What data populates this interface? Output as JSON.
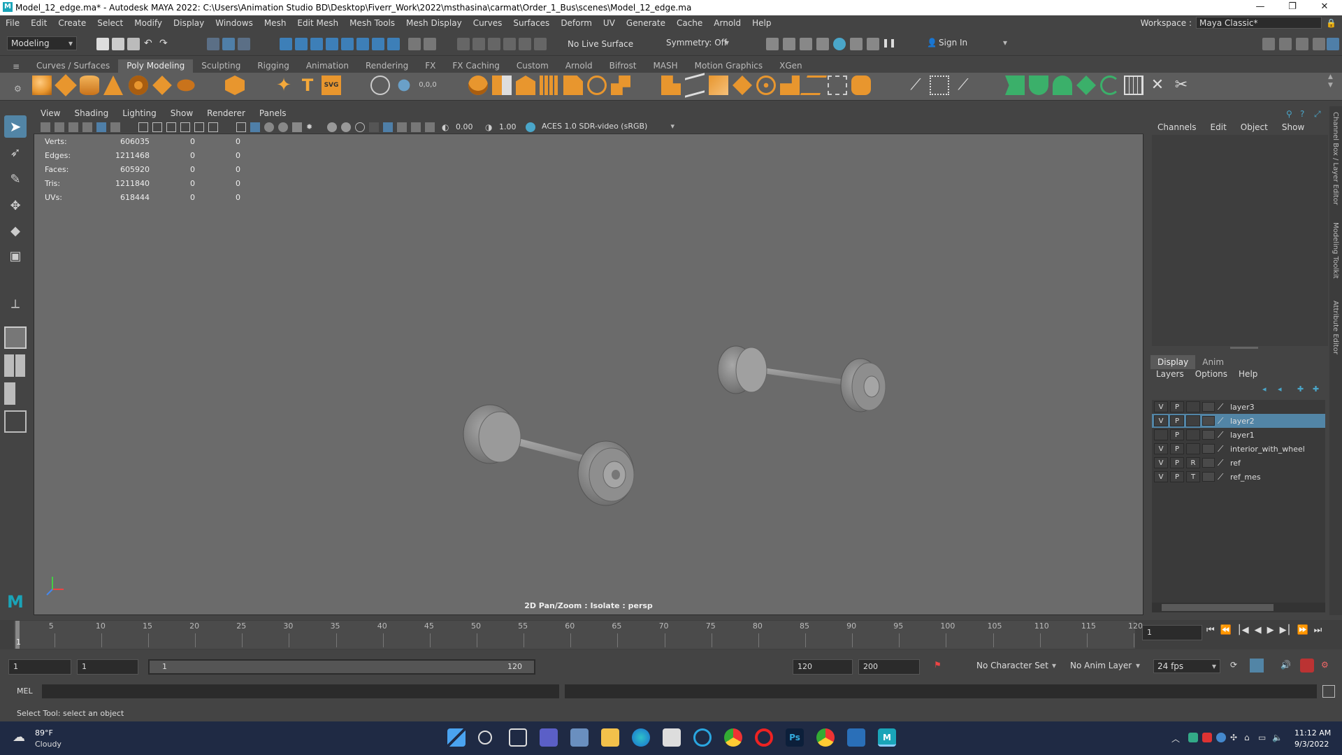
{
  "titlebar": {
    "title": "Model_12_edge.ma* - Autodesk MAYA 2022: C:\\Users\\Animation Studio BD\\Desktop\\Fiverr_Work\\2022\\msthasina\\carmat\\Order_1_Bus\\scenes\\Model_12_edge.ma",
    "logo_letter": "M"
  },
  "menubar": {
    "items": [
      "File",
      "Edit",
      "Create",
      "Select",
      "Modify",
      "Display",
      "Windows",
      "Mesh",
      "Edit Mesh",
      "Mesh Tools",
      "Mesh Display",
      "Curves",
      "Surfaces",
      "Deform",
      "UV",
      "Generate",
      "Cache",
      "Arnold",
      "Help"
    ],
    "workspace_label": "Workspace :",
    "workspace_value": "Maya Classic*"
  },
  "statusline": {
    "mode": "Modeling",
    "live_surface": "No Live Surface",
    "symmetry": "Symmetry: Off",
    "sign_in": "Sign In"
  },
  "shelf": {
    "tabs": [
      "Curves / Surfaces",
      "Poly Modeling",
      "Sculpting",
      "Rigging",
      "Animation",
      "Rendering",
      "FX",
      "FX Caching",
      "Custom",
      "Arnold",
      "Bifrost",
      "MASH",
      "Motion Graphics",
      "XGen"
    ],
    "active": "Poly Modeling",
    "text_icon_t": "T",
    "text_icon_svg": "SVG"
  },
  "viewport": {
    "menus": [
      "View",
      "Shading",
      "Lighting",
      "Show",
      "Renderer",
      "Panels"
    ],
    "exposure": "0.00",
    "gamma": "1.00",
    "color_space": "ACES 1.0 SDR-video (sRGB)",
    "hud": [
      {
        "label": "Verts:",
        "v1": "606035",
        "v2": "0",
        "v3": "0"
      },
      {
        "label": "Edges:",
        "v1": "1211468",
        "v2": "0",
        "v3": "0"
      },
      {
        "label": "Faces:",
        "v1": "605920",
        "v2": "0",
        "v3": "0"
      },
      {
        "label": "Tris:",
        "v1": "1211840",
        "v2": "0",
        "v3": "0"
      },
      {
        "label": "UVs:",
        "v1": "618444",
        "v2": "0",
        "v3": "0"
      }
    ],
    "camera_label": "2D Pan/Zoom : Isolate : persp"
  },
  "channelbox": {
    "menus": [
      "Channels",
      "Edit",
      "Object",
      "Show"
    ],
    "side_tabs": [
      "Channel Box / Layer Editor",
      "Modeling Toolkit",
      "Attribute Editor"
    ]
  },
  "layers": {
    "tabs": [
      "Display",
      "Anim"
    ],
    "active_tab": "Display",
    "menus": [
      "Layers",
      "Options",
      "Help"
    ],
    "rows": [
      {
        "v": "V",
        "p": "P",
        "r": "",
        "name": "layer3",
        "selected": false
      },
      {
        "v": "V",
        "p": "P",
        "r": "",
        "name": "layer2",
        "selected": true
      },
      {
        "v": "",
        "p": "P",
        "r": "",
        "name": "layer1",
        "selected": false
      },
      {
        "v": "V",
        "p": "P",
        "r": "",
        "name": "interior_with_wheel",
        "selected": false
      },
      {
        "v": "V",
        "p": "P",
        "r": "R",
        "name": "ref",
        "selected": false
      },
      {
        "v": "V",
        "p": "P",
        "r": "T",
        "name": "ref_mes",
        "selected": false
      }
    ]
  },
  "timeslider": {
    "labels": [
      "5",
      "10",
      "15",
      "20",
      "25",
      "30",
      "35",
      "40",
      "45",
      "50",
      "55",
      "60",
      "65",
      "70",
      "75",
      "80",
      "85",
      "90",
      "95",
      "100",
      "105",
      "110",
      "115",
      "120"
    ],
    "current": "1",
    "current_field": "1"
  },
  "range": {
    "start": "1",
    "anim_start": "1",
    "range_start": "1",
    "range_end": "120",
    "end": "120",
    "anim_end": "200",
    "character_set": "No Character Set",
    "anim_layer": "No Anim Layer",
    "fps": "24 fps"
  },
  "cmdline": {
    "label": "MEL"
  },
  "helpline": {
    "text": "Select Tool: select an object"
  },
  "taskbar": {
    "temp": "89°F",
    "weather": "Cloudy",
    "time": "11:12 AM",
    "date": "9/3/2022",
    "ps_label": "Ps"
  },
  "colors": {
    "selection": "#5285a6",
    "viewport_bg": "#6b6b6b",
    "maya_teal": "#1aa4b8",
    "shelf_orange": "#e8962e",
    "shelf_green": "#3bb06a"
  }
}
